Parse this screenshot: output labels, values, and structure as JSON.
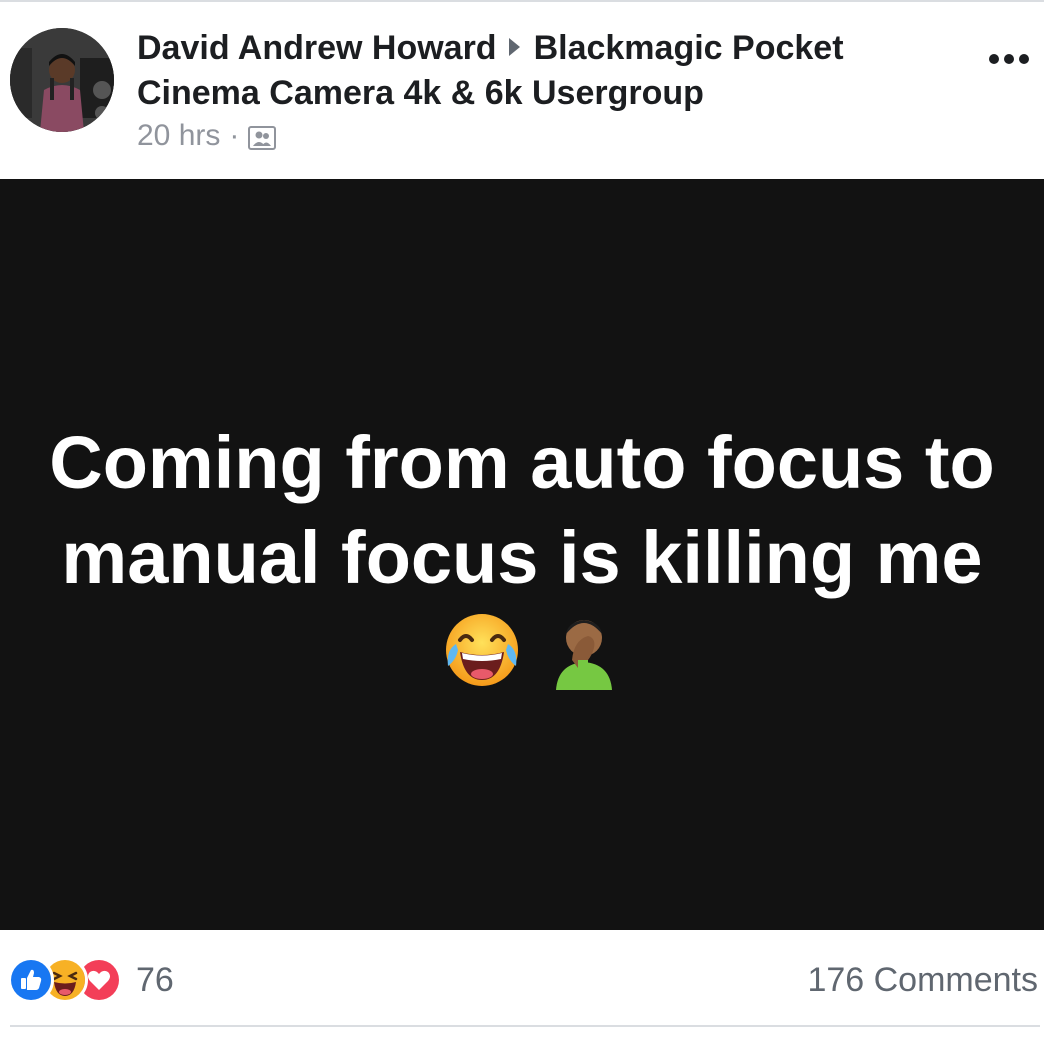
{
  "post": {
    "author": "David Andrew Howard",
    "group": "Blackmagic Pocket Cinema Camera 4k & 6k Usergroup",
    "timestamp": "20 hrs",
    "separator": "·",
    "audience_icon": "group-icon",
    "menu_icon": "more-options-icon",
    "body_text": "Coming from auto focus to manual focus is killing me",
    "body_emojis": [
      "face-with-tears-of-joy-icon",
      "person-facepalming-icon"
    ]
  },
  "footer": {
    "reaction_icons": [
      "like-icon",
      "haha-icon",
      "love-icon"
    ],
    "reaction_count": "76",
    "comments_label": "176 Comments"
  },
  "colors": {
    "post_background": "#121212",
    "like": "#1877f2",
    "love": "#f33e58",
    "haha": "#f7b125"
  }
}
